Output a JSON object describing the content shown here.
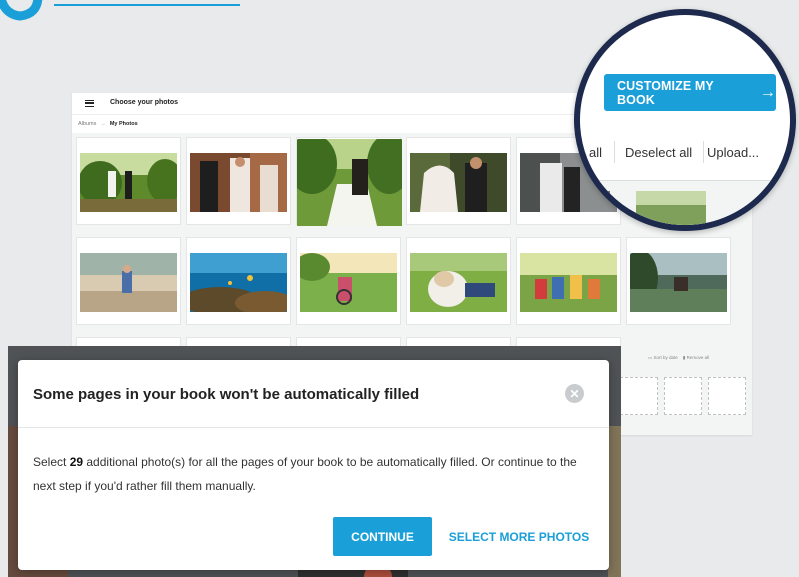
{
  "app": {
    "menu_icon": "hamburger-icon",
    "title": "Choose your photos",
    "breadcrumb": {
      "parent": "Albums",
      "separator": "→",
      "current": "My Photos"
    },
    "toolbar": {
      "select_all_partial": "all",
      "deselect_all": "Deselect all",
      "upload": "Upload...",
      "customize_label": "CUSTOMIZE MY BOOK",
      "customize_icon": "arrow-right-icon"
    },
    "sort_label": "Sort by date",
    "remove_label": "Remove all"
  },
  "dialog": {
    "title": "Some pages in your book won't be automatically filled",
    "close_icon": "close-icon",
    "body_prefix": "Select ",
    "body_count": "29",
    "body_suffix": " additional photo(s) for all the pages of your book to be automatically filled. Or continue to the next step if you'd rather fill them manually.",
    "continue_label": "CONTINUE",
    "select_more_label": "SELECT MORE PHOTOS"
  },
  "colors": {
    "accent": "#1a9fd8",
    "magnifier_ring": "#1d2a4d",
    "overlay": "#4f5356"
  }
}
